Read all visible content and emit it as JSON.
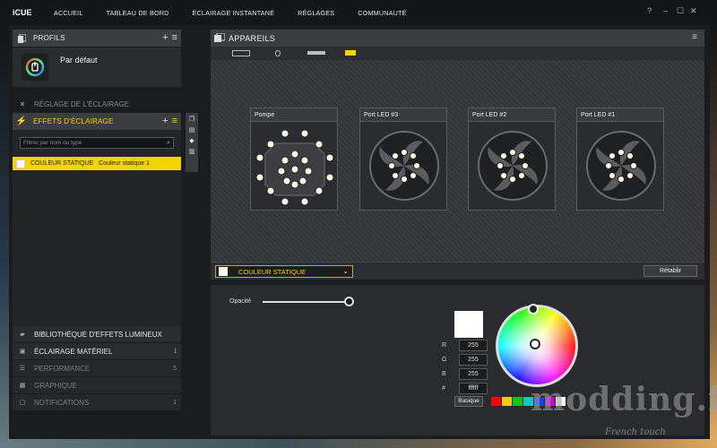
{
  "app": {
    "logo": "iCUE"
  },
  "nav": [
    "ACCUEIL",
    "TABLEAU DE BORD",
    "ÉCLAIRAGE INSTANTANÉ",
    "RÉGLAGES",
    "COMMUNAUTÉ"
  ],
  "window": {
    "help": "?",
    "minimize": "–",
    "maximize": "☐",
    "close": "✕"
  },
  "profiles": {
    "title": "PROFILS",
    "active_profile": "Par défaut",
    "add": "+",
    "menu": "≡"
  },
  "lighting_setup": {
    "title": "RÉGLAGE DE L'ÉCLAIRAGE"
  },
  "effects": {
    "title": "EFFETS D'ÉCLAIRAGE",
    "add": "+",
    "menu": "≡",
    "search_placeholder": "Filtrer par nom ou type",
    "items": [
      {
        "type": "COULEUR STATIQUE",
        "name": "Couleur statique 1"
      }
    ]
  },
  "bottom_menu": [
    {
      "label": "BIBLIOTHÈQUE D'EFFETS LUMINEUX",
      "count": ""
    },
    {
      "label": "ÉCLAIRAGE MATÉRIEL",
      "count": ""
    },
    {
      "label": "PERFORMANCE",
      "count": "5"
    },
    {
      "label": "GRAPHIQUE",
      "count": ""
    },
    {
      "label": "NOTIFICATIONS",
      "count": "1"
    }
  ],
  "devices": {
    "title": "APPAREILS",
    "cards": [
      {
        "label": "Pompe"
      },
      {
        "label": "Port LED #3"
      },
      {
        "label": "Port LED #2"
      },
      {
        "label": "Port LED #1"
      }
    ]
  },
  "effect_bar": {
    "selected": "COULEUR STATIQUE",
    "reset": "Rétablir"
  },
  "color": {
    "opacity_label": "Opacité",
    "opacity_level": 1.0,
    "preview": "#ffffff",
    "r_label": "R",
    "r": "255",
    "g_label": "G",
    "g": "255",
    "b_label": "B",
    "b": "255",
    "hex_label": "#",
    "hex": "ffffff",
    "basic": "Basique",
    "swatches": [
      "#ff0000",
      "#ffcc00",
      "#00cc00",
      "#00cccc",
      "#0044ff",
      "#cc00cc",
      "#ffffff"
    ]
  },
  "watermark": {
    "brand": "modding.fr",
    "tagline": "French touch"
  }
}
